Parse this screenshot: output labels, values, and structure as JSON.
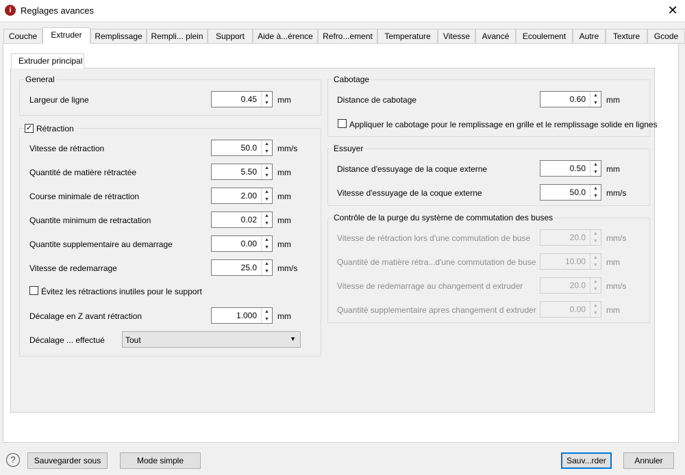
{
  "window": {
    "title": "Reglages avances",
    "tabs": [
      "Couche",
      "Extruder",
      "Remplissage",
      "Rempli... plein",
      "Support",
      "Aide à...érence",
      "Refro...ement",
      "Temperature",
      "Vitesse",
      "Avancé",
      "Ecoulement",
      "Autre",
      "Texture",
      "Gcode"
    ],
    "active_tab": "Extruder"
  },
  "subtab": "Extruder principal",
  "general": {
    "title": "General",
    "line_width": {
      "label": "Largeur de ligne",
      "value": "0.45",
      "unit": "mm"
    }
  },
  "retraction": {
    "title": "Rétraction",
    "checked": true,
    "fields": [
      {
        "label": "Vitesse de rétraction",
        "value": "50.0",
        "unit": "mm/s"
      },
      {
        "label": "Quantité de matière rétractée",
        "value": "5.50",
        "unit": "mm"
      },
      {
        "label": "Course minimale de rétraction",
        "value": "2.00",
        "unit": "mm"
      },
      {
        "label": "Quantite minimum de retractation",
        "value": "0.02",
        "unit": "mm"
      },
      {
        "label": "Quantite supplementaire au demarrage",
        "value": "0.00",
        "unit": "mm"
      },
      {
        "label": "Vitesse de redemarrage",
        "value": "25.0",
        "unit": "mm/s"
      }
    ],
    "avoid_support": {
      "label": "Évitez les rétractions inutiles pour le support",
      "checked": false
    },
    "z_offset": {
      "label": "Décalage en Z avant rétraction",
      "value": "1.000",
      "unit": "mm"
    },
    "offset_done": {
      "label": "Décalage ... effectué",
      "value": "Tout"
    }
  },
  "coasting": {
    "title": "Cabotage",
    "distance": {
      "label": "Distance de cabotage",
      "value": "0.60",
      "unit": "mm"
    },
    "apply_infill": {
      "label": "Appliquer le cabotage pour le remplissage en grille et le remplissage solide en lignes",
      "checked": false
    }
  },
  "wipe": {
    "title": "Essuyer",
    "fields": [
      {
        "label": "Distance d'essuyage de la coque externe",
        "value": "0.50",
        "unit": "mm"
      },
      {
        "label": "Vitesse d'essuyage de la coque externe",
        "value": "50.0",
        "unit": "mm/s"
      }
    ]
  },
  "nozzle_switch": {
    "title": "Contrôle de la purge du système de commutation des buses",
    "fields": [
      {
        "label": "Vitesse de rétraction lors d'une commutation de buse",
        "value": "20.0",
        "unit": "mm/s"
      },
      {
        "label": "Quantité de matière rétra...d'une commutation de buse",
        "value": "10.00",
        "unit": "mm"
      },
      {
        "label": "Vitesse de redemarrage au changement d extruder",
        "value": "20.0",
        "unit": "mm/s"
      },
      {
        "label": "Quantité supplementaire apres changement d extruder",
        "value": "0.00",
        "unit": "mm"
      }
    ]
  },
  "footer": {
    "help": "?",
    "save_as": "Sauvegarder sous",
    "simple_mode": "Mode simple",
    "save": "Sauv...rder",
    "cancel": "Annuler"
  }
}
